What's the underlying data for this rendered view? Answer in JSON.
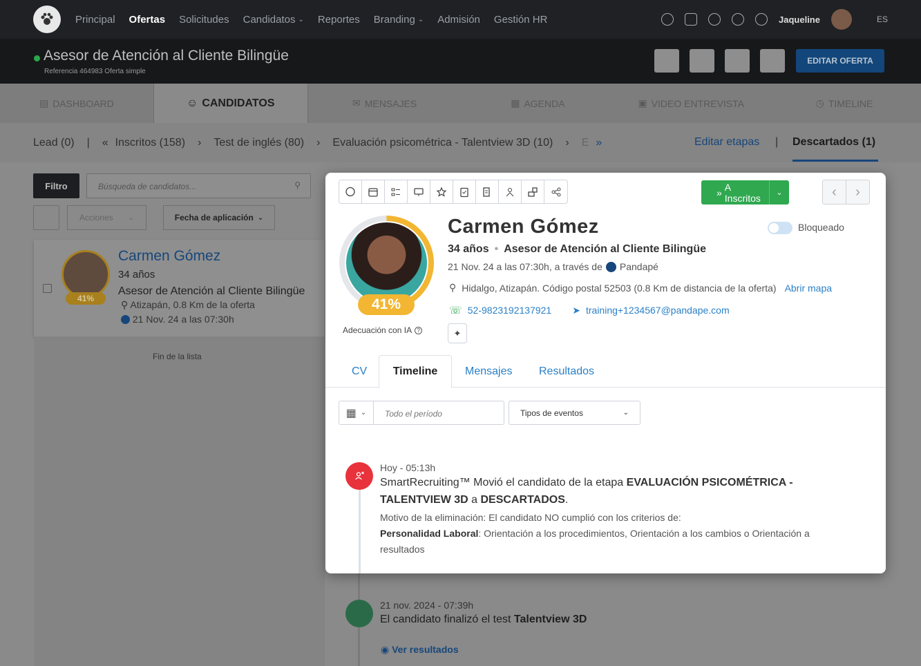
{
  "topnav": {
    "items": [
      "Principal",
      "Ofertas",
      "Solicitudes",
      "Candidatos",
      "Reportes",
      "Branding",
      "Admisión",
      "Gestión HR"
    ],
    "user": "Jaqueline",
    "lang": "ES"
  },
  "job": {
    "title": "Asesor de Atención al Cliente Bilingüe",
    "reference": "Referencia 464983 Oferta simple",
    "edit_button": "EDITAR OFERTA"
  },
  "main_tabs": [
    "DASHBOARD",
    "CANDIDATOS",
    "MENSAJES",
    "AGENDA",
    "VIDEO ENTREVISTA",
    "TIMELINE"
  ],
  "stages": {
    "items": [
      "Lead (0)",
      "Inscritos (158)",
      "Test de inglés (80)",
      "Evaluación psicométrica - Talentview 3D (10)",
      "E"
    ],
    "edit_link": "Editar etapas",
    "discarded": "Descartados (1)"
  },
  "list": {
    "filter_button": "Filtro",
    "search_placeholder": "Búsqueda de candidatos...",
    "actions": "Acciones",
    "sort": "Fecha de aplicación",
    "end": "Fin de la lista",
    "candidate": {
      "pct": "41%",
      "name": "Carmen Gómez",
      "age": "34 años",
      "position": "Asesor de Atención al Cliente Bilingüe",
      "location": "Atizapán, 0.8 Km de la oferta",
      "date": "21 Nov. 24 a las 07:30h"
    }
  },
  "profile": {
    "move_button": "A Inscritos",
    "name": "Carmen Gómez",
    "blocked_label": "Bloqueado",
    "age": "34 años",
    "position": "Asesor de Atención al Cliente Bilingüe",
    "applied": "21 Nov. 24 a las 07:30h, a través de",
    "source": "Pandapé",
    "location": "Hidalgo, Atizapán. Código postal 52503 (0.8 Km de distancia de la oferta)",
    "map_link": "Abrir mapa",
    "phone": "52-9823192137921",
    "email": "training+1234567@pandape.com",
    "match_pct": "41%",
    "match_pct_value": 41,
    "ia_label": "Adecuación con IA"
  },
  "profile_tabs": [
    "CV",
    "Timeline",
    "Mensajes",
    "Resultados"
  ],
  "timeline_filters": {
    "period_placeholder": "Todo el período",
    "event_types": "Tipos de eventos"
  },
  "events": [
    {
      "date": "Hoy - 05:13h",
      "text_a": "SmartRecruiting™ Movió el candidato de la etapa ",
      "text_b": "EVALUACIÓN PSICOMÉTRICA - TALENTVIEW 3D",
      "text_c": " a ",
      "text_d": "DESCARTADOS",
      "text_e": ".",
      "reason_a": "Motivo de la eliminación: El candidato NO cumplió con los criterios de:",
      "reason_b": "Personalidad Laboral",
      "reason_c": ": Orientación a los procedimientos, Orientación a los cambios o Orientación a resultados"
    },
    {
      "date": "21 nov. 2024 - 07:39h",
      "text_a": "El candidato finalizó el test ",
      "text_b": "Talentview 3D",
      "link": "Ver resultados"
    }
  ],
  "colors": {
    "accent": "#2a80c8",
    "green": "#2fa84f",
    "match": "#f2b632",
    "discard": "#e8323c"
  }
}
